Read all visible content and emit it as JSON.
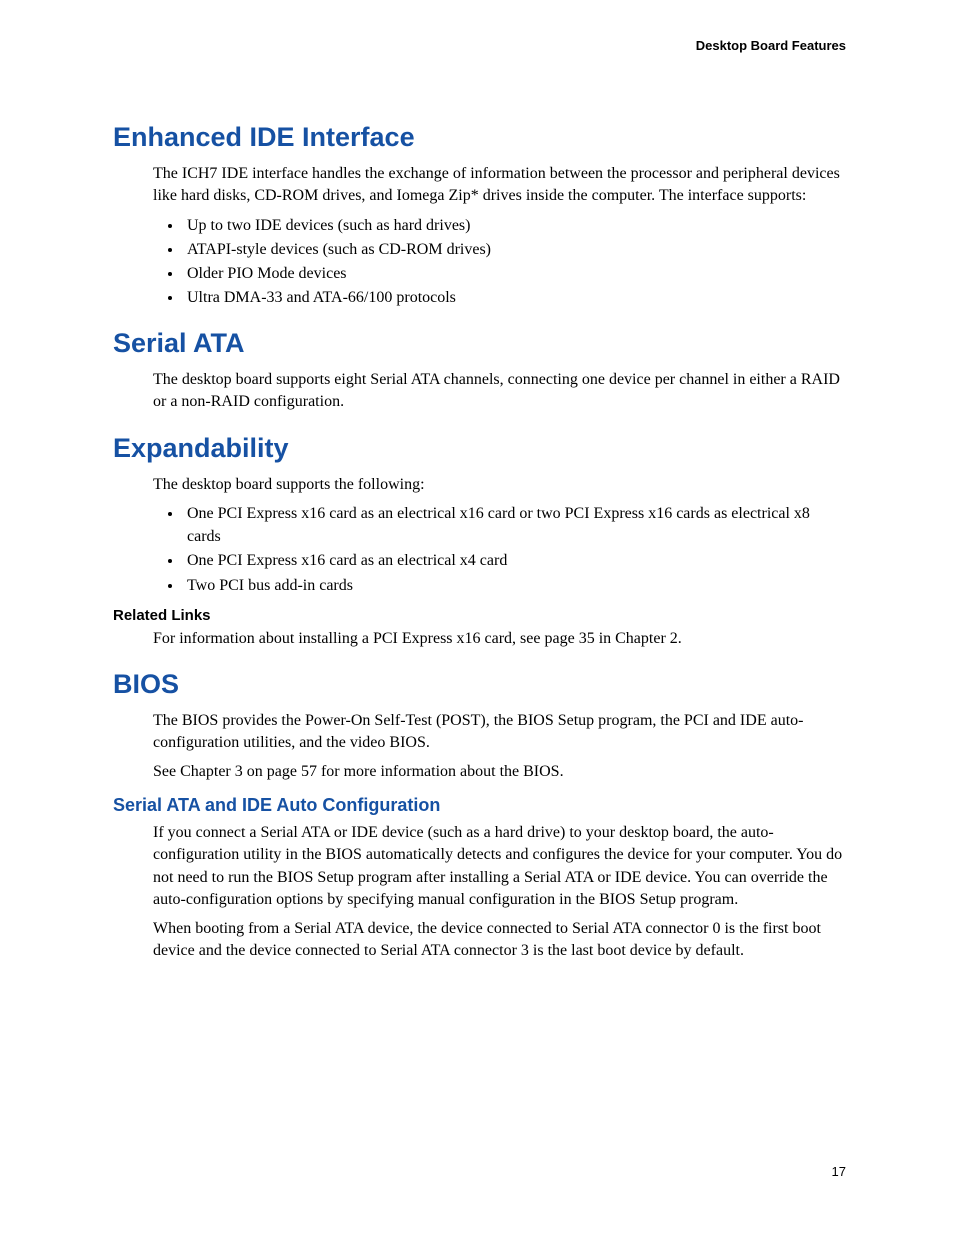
{
  "header": "Desktop Board Features",
  "page_number": "17",
  "sections": {
    "ide": {
      "title": "Enhanced IDE Interface",
      "intro": "The ICH7 IDE interface handles the exchange of information between the processor and peripheral devices like hard disks, CD-ROM drives, and Iomega Zip* drives inside the computer.  The interface supports:",
      "bullets": [
        "Up to two IDE devices (such as hard drives)",
        "ATAPI-style devices (such as CD-ROM drives)",
        "Older PIO Mode devices",
        "Ultra DMA-33 and ATA-66/100 protocols"
      ]
    },
    "sata": {
      "title": "Serial ATA",
      "p1": "The desktop board supports eight Serial ATA channels, connecting one device per channel in either a RAID or a non-RAID configuration."
    },
    "expand": {
      "title": "Expandability",
      "intro": "The desktop board supports the following:",
      "bullets": [
        "One PCI Express x16 card as an electrical x16 card or two PCI Express x16 cards as electrical x8 cards",
        "One PCI Express x16 card as an electrical x4 card",
        "Two PCI bus add-in cards"
      ],
      "related_title": "Related Links",
      "related_p": "For information about installing a PCI Express x16 card, see page 35 in Chapter 2."
    },
    "bios": {
      "title": "BIOS",
      "p1": "The BIOS provides the Power-On Self-Test (POST), the BIOS Setup program, the PCI and IDE auto-configuration utilities, and the video BIOS.",
      "p2": "See Chapter 3 on page 57 for more information about the BIOS.",
      "sub_title": "Serial ATA and IDE Auto Configuration",
      "sub_p1": "If you connect a Serial ATA or IDE device (such as a hard drive) to your desktop board, the auto-configuration utility in the BIOS automatically detects and configures the device for your computer.  You do not need to run the BIOS Setup program after installing a Serial ATA or IDE device.  You can override the auto-configuration options by specifying manual configuration in the BIOS Setup program.",
      "sub_p2": "When booting from a Serial ATA device, the device connected to Serial ATA connector 0 is the first boot device and the device connected to Serial ATA connector 3 is the last boot device by default."
    }
  }
}
